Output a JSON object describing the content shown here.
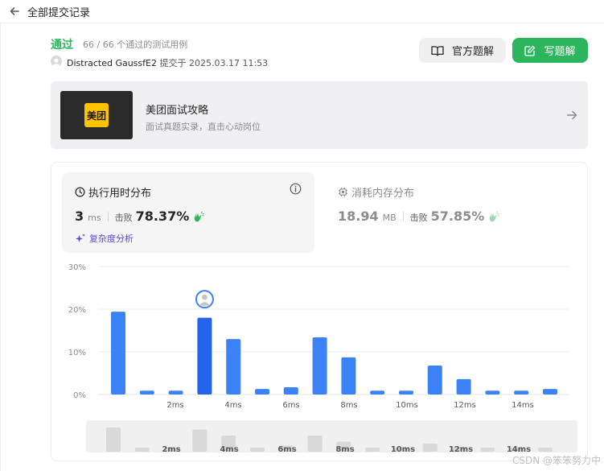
{
  "header": {
    "title": "全部提交记录"
  },
  "submission": {
    "status": "通过",
    "cases": "66 / 66 个通过的测试用例",
    "author": "Distracted GaussfE2",
    "submitted_label": "提交于",
    "submitted_time": "2025.03.17 11:53"
  },
  "actions": {
    "official_solution": "官方题解",
    "write_solution": "写题解"
  },
  "banner": {
    "logo_text": "美团",
    "title": "美团面试攻略",
    "subtitle": "面试真题实录，直击心动岗位"
  },
  "runtime": {
    "title": "执行用时分布",
    "value": "3",
    "unit": "ms",
    "beats_label": "击败",
    "beats": "78.37%",
    "complexity_label": "复杂度分析"
  },
  "memory": {
    "title": "消耗内存分布",
    "value": "18.94",
    "unit": "MB",
    "beats_label": "击败",
    "beats": "57.85%"
  },
  "colors": {
    "accent": "#2db55d",
    "bar": "#3b82f6",
    "bar_selected": "#2563eb",
    "complexity": "#5b49d8"
  },
  "chart_data": {
    "type": "bar",
    "x": [
      1,
      1.5,
      2,
      3,
      3.5,
      4,
      5,
      6,
      7,
      8,
      9,
      10,
      11,
      12,
      13,
      14,
      15
    ],
    "values": [
      19.4,
      0.9,
      0.9,
      18.0,
      13.0,
      1.3,
      1.7,
      13.4,
      8.7,
      0.9,
      0.9,
      6.8,
      3.6,
      0.9,
      0.9,
      1.3
    ],
    "selected_index": 3,
    "y_ticks": [
      "30%",
      "20%",
      "10%",
      "0%"
    ],
    "ylim": [
      0,
      30
    ],
    "x_ticks": [
      "2ms",
      "4ms",
      "6ms",
      "8ms",
      "10ms",
      "12ms",
      "14ms"
    ],
    "brush_values": [
      6,
      1,
      1,
      5.5,
      4,
      1,
      1.5,
      4,
      2.5,
      1,
      1,
      2,
      1.2,
      1,
      1,
      1
    ]
  },
  "watermark": "CSDN @笨笨努力中"
}
